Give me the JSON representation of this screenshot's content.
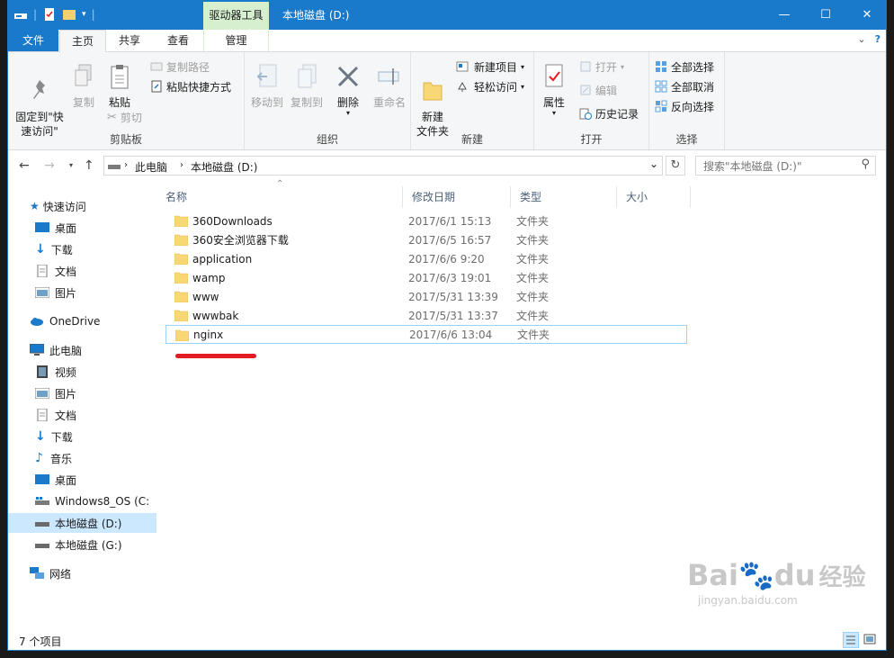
{
  "window": {
    "title": "本地磁盘 (D:)",
    "context_tab": "驱动器工具",
    "controls": [
      "—",
      "☐",
      "✕"
    ]
  },
  "tabs": {
    "file": "文件",
    "home": "主页",
    "share": "共享",
    "view": "查看",
    "manage": "管理",
    "help_icon": "?"
  },
  "ribbon": {
    "clipboard": {
      "label": "剪贴板",
      "pin": "固定到\"快\n速访问\"",
      "copy": "复制",
      "paste": "粘贴",
      "copy_path": "复制路径",
      "paste_shortcut": "粘贴快捷方式",
      "cut": "剪切"
    },
    "organize": {
      "label": "组织",
      "move_to": "移动到",
      "copy_to": "复制到",
      "delete": "删除",
      "rename": "重命名"
    },
    "new": {
      "label": "新建",
      "new_folder": "新建\n文件夹",
      "new_item": "新建项目",
      "easy_access": "轻松访问"
    },
    "open": {
      "label": "打开",
      "properties": "属性",
      "open": "打开",
      "edit": "编辑",
      "history": "历史记录"
    },
    "select": {
      "label": "选择",
      "select_all": "全部选择",
      "select_none": "全部取消",
      "invert": "反向选择"
    }
  },
  "address": {
    "crumbs": [
      "此电脑",
      "本地磁盘 (D:)"
    ],
    "search_placeholder": "搜索\"本地磁盘 (D:)\""
  },
  "sidebar": {
    "quick_access": "快速访问",
    "quick_items": [
      "桌面",
      "下载",
      "文档",
      "图片"
    ],
    "onedrive": "OneDrive",
    "this_pc": "此电脑",
    "pc_items": [
      "视频",
      "图片",
      "文档",
      "下载",
      "音乐",
      "桌面",
      "Windows8_OS (C:",
      "本地磁盘 (D:)",
      "本地磁盘 (G:)"
    ],
    "network": "网络"
  },
  "columns": {
    "name": "名称",
    "date": "修改日期",
    "type": "类型",
    "size": "大小"
  },
  "files": [
    {
      "name": "360Downloads",
      "date": "2017/6/1 15:13",
      "type": "文件夹"
    },
    {
      "name": "360安全浏览器下载",
      "date": "2017/6/5 16:57",
      "type": "文件夹"
    },
    {
      "name": "application",
      "date": "2017/6/6 9:20",
      "type": "文件夹"
    },
    {
      "name": "wamp",
      "date": "2017/6/3 19:01",
      "type": "文件夹"
    },
    {
      "name": "www",
      "date": "2017/5/31 13:39",
      "type": "文件夹"
    },
    {
      "name": "wwwbak",
      "date": "2017/5/31 13:37",
      "type": "文件夹"
    },
    {
      "name": "nginx",
      "date": "2017/6/6 13:04",
      "type": "文件夹"
    }
  ],
  "status": {
    "count": "7 个项目"
  },
  "watermark": {
    "brand": "Bai",
    "brand2": "du",
    "suffix": "经验",
    "url": "jingyan.baidu.com"
  },
  "colors": {
    "accent": "#1979ca",
    "context": "#d6f0cf",
    "selection": "#cce8ff",
    "annotation": "#e31b23"
  }
}
